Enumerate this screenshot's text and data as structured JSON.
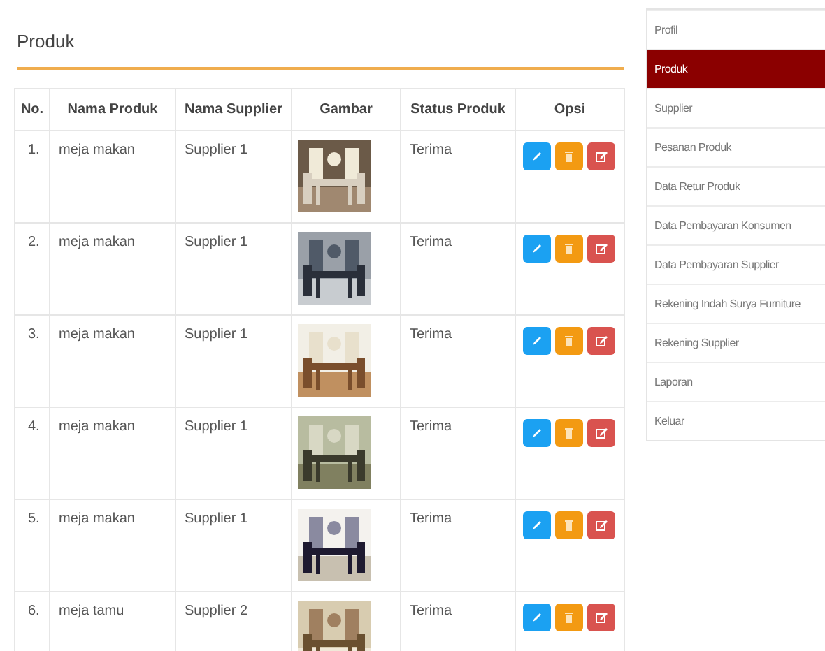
{
  "page": {
    "title": "Produk"
  },
  "table": {
    "columns": [
      "No.",
      "Nama Produk",
      "Nama Supplier",
      "Gambar",
      "Status Produk",
      "Opsi"
    ],
    "rows": [
      {
        "no": "1.",
        "nama_produk": "meja makan",
        "nama_supplier": "Supplier 1",
        "status": "Terima"
      },
      {
        "no": "2.",
        "nama_produk": "meja makan",
        "nama_supplier": "Supplier 1",
        "status": "Terima"
      },
      {
        "no": "3.",
        "nama_produk": "meja makan",
        "nama_supplier": "Supplier 1",
        "status": "Terima"
      },
      {
        "no": "4.",
        "nama_produk": "meja makan",
        "nama_supplier": "Supplier 1",
        "status": "Terima"
      },
      {
        "no": "5.",
        "nama_produk": "meja makan",
        "nama_supplier": "Supplier 1",
        "status": "Terima"
      },
      {
        "no": "6.",
        "nama_produk": "meja tamu",
        "nama_supplier": "Supplier 2",
        "status": "Terima"
      }
    ]
  },
  "sidebar": {
    "items": [
      {
        "label": "Profil",
        "selected": false
      },
      {
        "label": "Produk",
        "selected": true
      },
      {
        "label": "Supplier",
        "selected": false
      },
      {
        "label": "Pesanan Produk",
        "selected": false
      },
      {
        "label": "Data Retur Produk",
        "selected": false
      },
      {
        "label": "Data Pembayaran Konsumen",
        "selected": false
      },
      {
        "label": "Data Pembayaran Supplier",
        "selected": false
      },
      {
        "label": "Rekening Indah Surya Furniture",
        "selected": false
      },
      {
        "label": "Rekening Supplier",
        "selected": false
      },
      {
        "label": "Laporan",
        "selected": false
      },
      {
        "label": "Keluar",
        "selected": false
      }
    ]
  }
}
